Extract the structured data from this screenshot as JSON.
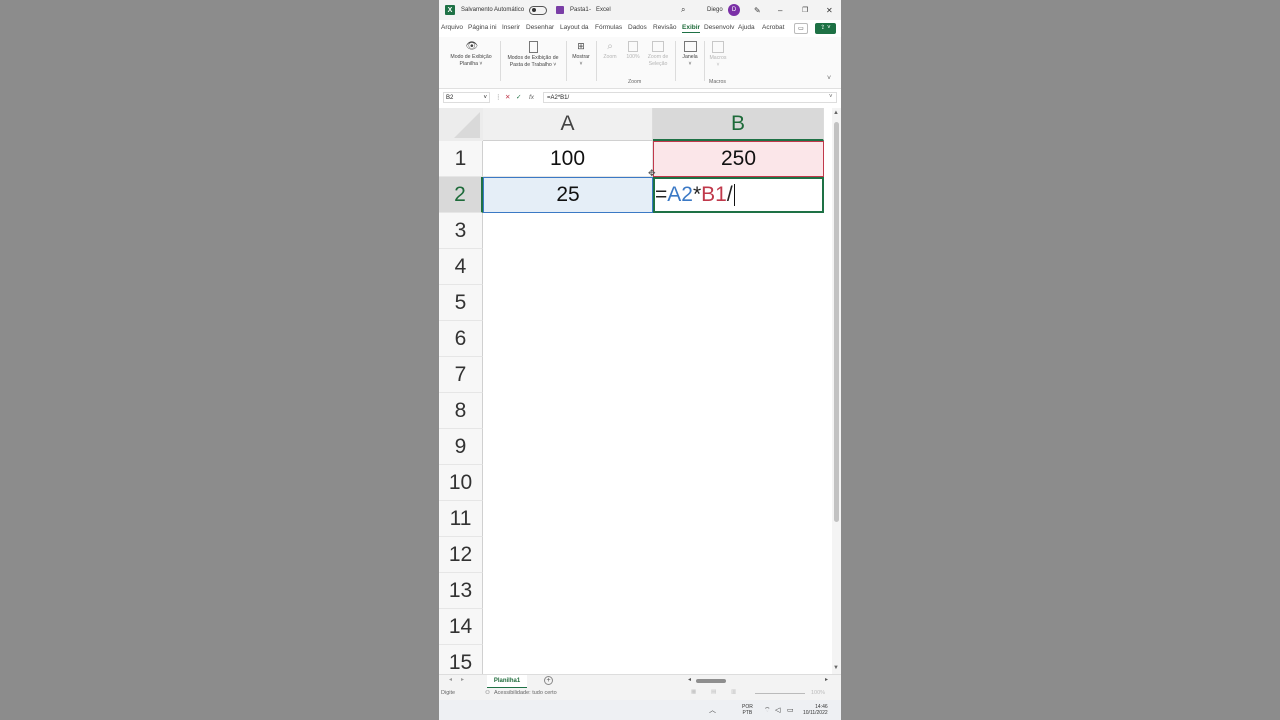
{
  "titlebar": {
    "autosave_label": "Salvamento Automático",
    "filename": "Pasta1",
    "separator": "-",
    "app_name": "Excel",
    "user_name": "Diego",
    "avatar_initial": "D"
  },
  "tabs": [
    "Arquivo",
    "Página ini",
    "Inserir",
    "Desenhar",
    "Layout da",
    "Fórmulas",
    "Dados",
    "Revisão",
    "Exibir",
    "Desenvolv",
    "Ajuda",
    "Acrobat"
  ],
  "active_tab": "Exibir",
  "ribbon": {
    "modo_exibicao_planilha": [
      "Modo de Exibição",
      "Planilha ˅"
    ],
    "modos_exibicao_pasta": [
      "Modos de Exibição de",
      "Pasta de Trabalho ˅"
    ],
    "mostrar": "Mostrar",
    "zoom": "Zoom",
    "zoom_100": "100%",
    "zoom_selecao": [
      "Zoom de",
      "Seleção"
    ],
    "group_zoom": "Zoom",
    "janela": "Janela",
    "macros": "Macros",
    "group_macros": "Macros"
  },
  "formula_bar": {
    "name_box": "B2",
    "fx": "fx",
    "formula": "=A2*B1/"
  },
  "grid": {
    "columns": [
      "A",
      "B"
    ],
    "rows": [
      "1",
      "2",
      "3",
      "4",
      "5",
      "6",
      "7",
      "8",
      "9",
      "10",
      "11",
      "12",
      "13",
      "14",
      "15"
    ],
    "A1": "100",
    "B1": "250",
    "A2": "25",
    "B2_parts": {
      "eq": "=",
      "ref_a": "A2",
      "op": "*",
      "ref_b": "B1",
      "slash": "/"
    }
  },
  "sheet": {
    "tab_name": "Planilha1",
    "add_symbol": "+"
  },
  "status": {
    "mode": "Digite",
    "accessibility": "Acessibilidade: tudo certo",
    "zoom_percent": "100%"
  },
  "taskbar": {
    "lang_top": "POR",
    "lang_bottom": "PTB",
    "time": "14:46",
    "date": "10/11/2022"
  },
  "colors": {
    "excel_green": "#1e7145",
    "ref_blue": "#3b79c5",
    "ref_red": "#c0394b"
  }
}
